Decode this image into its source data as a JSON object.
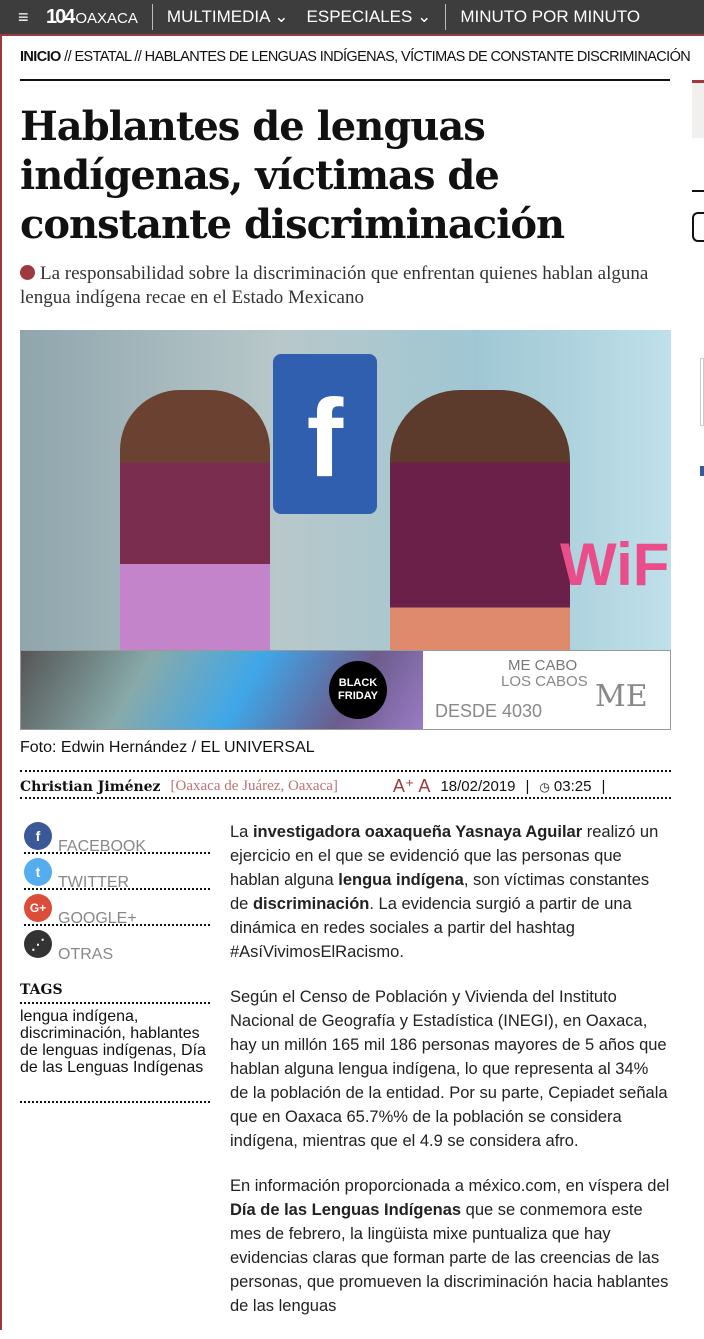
{
  "header": {
    "logo_number": "104",
    "logo_text": "OAXACA",
    "nav": [
      "MULTIMEDIA",
      "ESPECIALES",
      "MINUTO POR MINUTO"
    ]
  },
  "breadcrumb": {
    "home": "INICIO",
    "sep": " // ",
    "section": "ESTATAL",
    "current": "HABLANTES DE LENGUAS INDÍGENAS, VÍCTIMAS DE CONSTANTE DISCRIMINACIÓN"
  },
  "article": {
    "title": "Hablantes de lenguas indígenas, víctimas de constante discriminación",
    "summary": "La responsabilidad sobre la discriminación que enfrentan quienes hablan alguna lengua indígena recae en el Estado Mexicano",
    "photo_credit": "Foto: Edwin Hernández / EL UNIVERSAL",
    "author": "Christian Jiménez",
    "location": "Oaxaca de Juárez, Oaxaca",
    "font_size_icon": "A⁺ A",
    "date": "18/02/2019",
    "time": "03:25",
    "paragraphs": [
      [
        "La ",
        "investigadora oaxaqueña Yasnaya Aguilar",
        " realizó un ejercicio en el que se evidenció que las personas que hablan alguna ",
        "lengua indígena",
        ", son víctimas constantes de ",
        "discriminación",
        ". La evidencia surgió a partir de una dinámica en redes sociales a partir del hashtag #AsíVivimosElRacismo."
      ],
      "Según el Censo de Población y Vivienda del Instituto Nacional de Geografía y Estadística (INEGI), en Oaxaca, hay un millón 165 mil 186 personas mayores de 5 años que hablan alguna lengua indígena, lo que representa al 34% de la población de la entidad. Por su parte, Cepiadet señala que en Oaxaca 65.7%% de la población se considera indígena, mientras que el 4.9 se considera afro.",
      [
        "En información proporcionada a méxico.com, en víspera del ",
        "Día de las Lenguas Indígenas",
        " que se conmemora este mes de febrero, la lingüista mixe puntualiza que hay evidencias claras que forman parte de las creencias de las personas, que promueven la discriminación hacia hablantes de las lenguas"
      ]
    ]
  },
  "ad": {
    "badge": "BLACK FRIDAY",
    "line1": "ME CABO",
    "line2": "LOS CABOS",
    "price": "DESDE 4030",
    "brand": "ME"
  },
  "share": [
    {
      "label": "FACEBOOK",
      "icon": "f",
      "color": "#3b5998"
    },
    {
      "label": "TWITTER",
      "icon": "🐦",
      "color": "#55acee"
    },
    {
      "label": "GOOGLE+",
      "icon": "G+",
      "color": "#dd4b39"
    },
    {
      "label": "OTRAS",
      "icon": "⋰",
      "color": "#333333"
    }
  ],
  "tags": {
    "heading": "TAGS",
    "list": "lengua indígena, discriminación, hablantes de lenguas indígenas, Día de las Lenguas Indígenas"
  },
  "photo_text": {
    "fb": "f",
    "wifi": "WiFi"
  }
}
